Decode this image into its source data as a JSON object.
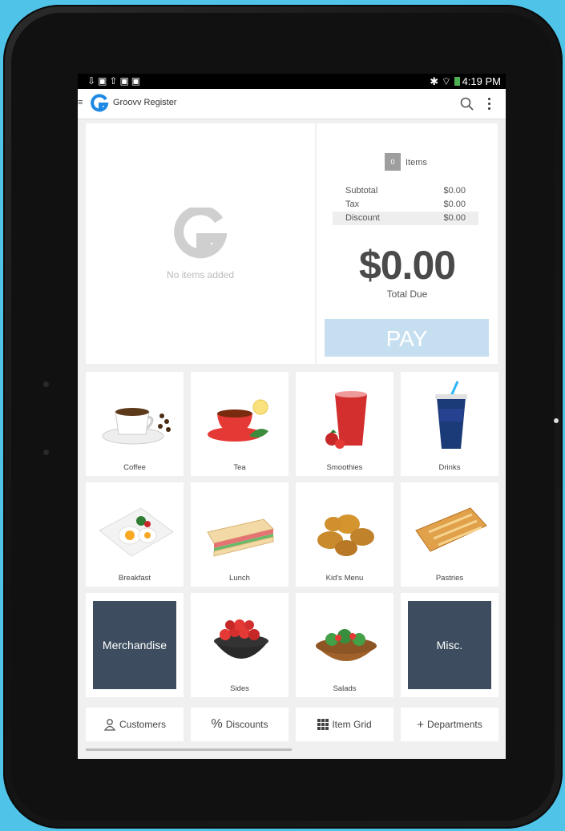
{
  "status_bar": {
    "time": "4:19 PM"
  },
  "app": {
    "title": "Groovv Register"
  },
  "cart": {
    "empty_text": "No items added"
  },
  "summary": {
    "item_count": "0",
    "items_label": "Items",
    "rows": [
      {
        "label": "Subtotal",
        "value": "$0.00"
      },
      {
        "label": "Tax",
        "value": "$0.00"
      },
      {
        "label": "Discount",
        "value": "$0.00"
      }
    ],
    "total": "$0.00",
    "total_label": "Total Due",
    "pay_label": "PAY"
  },
  "categories": [
    {
      "label": "Coffee",
      "icon": "coffee-icon"
    },
    {
      "label": "Tea",
      "icon": "tea-icon"
    },
    {
      "label": "Smoothies",
      "icon": "smoothie-icon"
    },
    {
      "label": "Drinks",
      "icon": "drink-icon"
    },
    {
      "label": "Breakfast",
      "icon": "breakfast-icon"
    },
    {
      "label": "Lunch",
      "icon": "sandwich-icon"
    },
    {
      "label": "Kid's Menu",
      "icon": "nuggets-icon"
    },
    {
      "label": "Pastries",
      "icon": "pastry-icon"
    },
    {
      "label": "Merchandise",
      "icon": ""
    },
    {
      "label": "Sides",
      "icon": "berries-icon"
    },
    {
      "label": "Salads",
      "icon": "salad-icon"
    },
    {
      "label": "Misc.",
      "icon": ""
    }
  ],
  "bottom_bar": {
    "customers": "Customers",
    "discounts": "Discounts",
    "item_grid": "Item Grid",
    "departments": "Departments"
  },
  "colors": {
    "accent": "#1e88e5",
    "pay": "#c6dff0",
    "dark_tile": "#3d4d5f",
    "background": "#4fc3e8"
  }
}
